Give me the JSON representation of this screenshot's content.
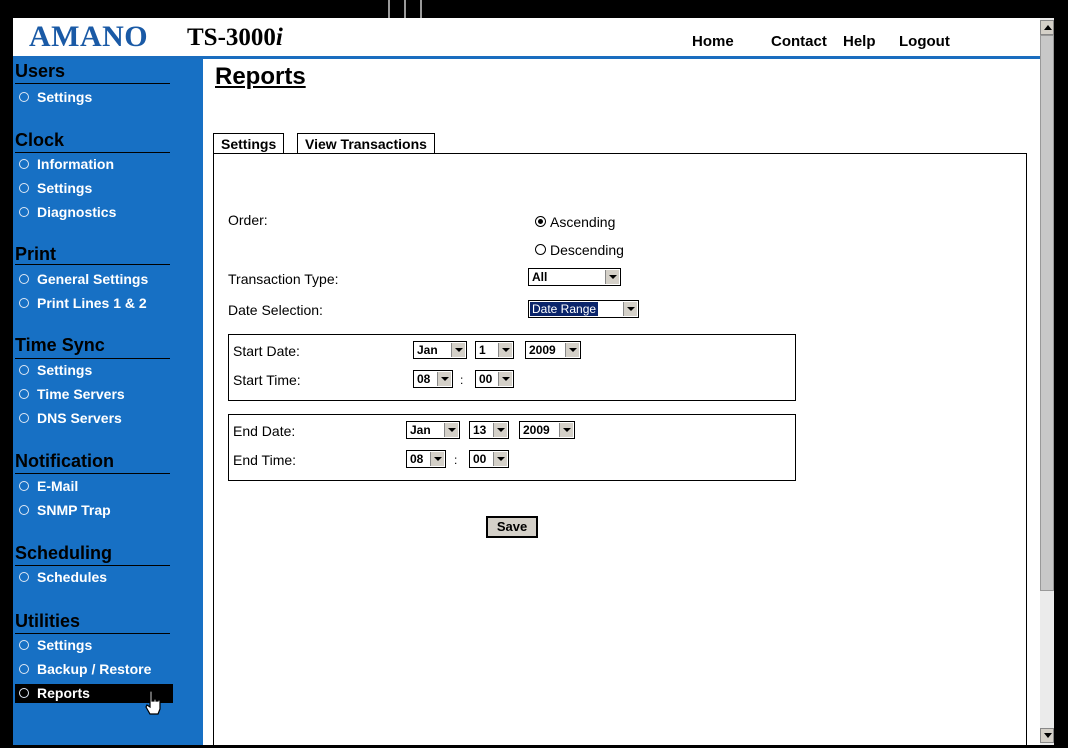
{
  "header": {
    "brand": "AMANO",
    "model": "TS-3000",
    "model_suffix": "i",
    "nav": [
      "Home",
      "Contact",
      "Help",
      "Logout"
    ]
  },
  "sidebar": {
    "sections": [
      {
        "title": "Users",
        "items": [
          "Settings"
        ]
      },
      {
        "title": "Clock",
        "items": [
          "Information",
          "Settings",
          "Diagnostics"
        ]
      },
      {
        "title": "Print",
        "items": [
          "General Settings",
          "Print Lines 1 & 2"
        ]
      },
      {
        "title": "Time Sync",
        "items": [
          "Settings",
          "Time Servers",
          "DNS Servers"
        ]
      },
      {
        "title": "Notification",
        "items": [
          "E-Mail",
          "SNMP Trap"
        ]
      },
      {
        "title": "Scheduling",
        "items": [
          "Schedules"
        ]
      },
      {
        "title": "Utilities",
        "items": [
          "Settings",
          "Backup / Restore",
          "Reports"
        ]
      }
    ],
    "active_item": "Reports"
  },
  "main": {
    "title": "Reports",
    "tabs": [
      "Settings",
      "View Transactions"
    ],
    "active_tab": "Settings",
    "form": {
      "order_label": "Order:",
      "order_options": [
        "Ascending",
        "Descending"
      ],
      "order_selected": "Ascending",
      "transaction_type_label": "Transaction Type:",
      "transaction_type_value": "All",
      "date_selection_label": "Date Selection:",
      "date_selection_value": "Date Range",
      "start": {
        "date_label": "Start Date:",
        "month": "Jan",
        "day": "1",
        "year": "2009",
        "time_label": "Start Time:",
        "hour": "08",
        "minute": "00"
      },
      "end": {
        "date_label": "End Date:",
        "month": "Jan",
        "day": "13",
        "year": "2009",
        "time_label": "End Time:",
        "hour": "08",
        "minute": "00"
      },
      "time_separator": ":",
      "save_label": "Save"
    }
  }
}
